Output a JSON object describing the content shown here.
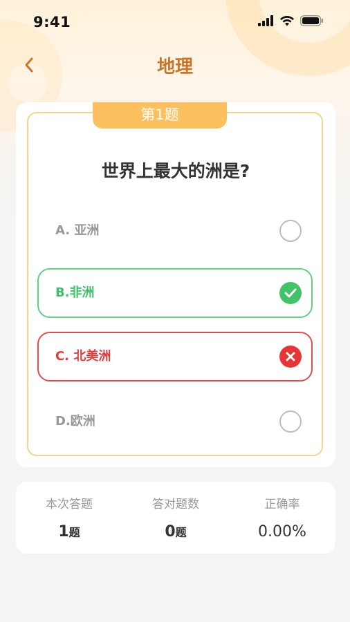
{
  "status_bar": {
    "time": "9:41",
    "icons": [
      "signal-icon",
      "wifi-icon",
      "battery-icon"
    ]
  },
  "nav": {
    "title": "地理",
    "back_icon": "chevron-left-icon"
  },
  "question": {
    "badge": "第1题",
    "text": "世界上最大的洲是?",
    "options": [
      {
        "label": "A. 亚洲",
        "state": "unselected"
      },
      {
        "label": "B.非洲",
        "state": "correct"
      },
      {
        "label": "C. 北美洲",
        "state": "wrong"
      },
      {
        "label": "D.欧洲",
        "state": "unselected"
      }
    ]
  },
  "stats": {
    "answered": {
      "label": "本次答题",
      "value": "1",
      "unit": "题"
    },
    "correct": {
      "label": "答对题数",
      "value": "0",
      "unit": "题"
    },
    "rate": {
      "label": "正确率",
      "value": "0.00%"
    }
  },
  "colors": {
    "accent": "#c8752a",
    "badge": "#fcc15e",
    "correct": "#41c468",
    "wrong": "#e53535",
    "card_border": "#f6d48c"
  }
}
